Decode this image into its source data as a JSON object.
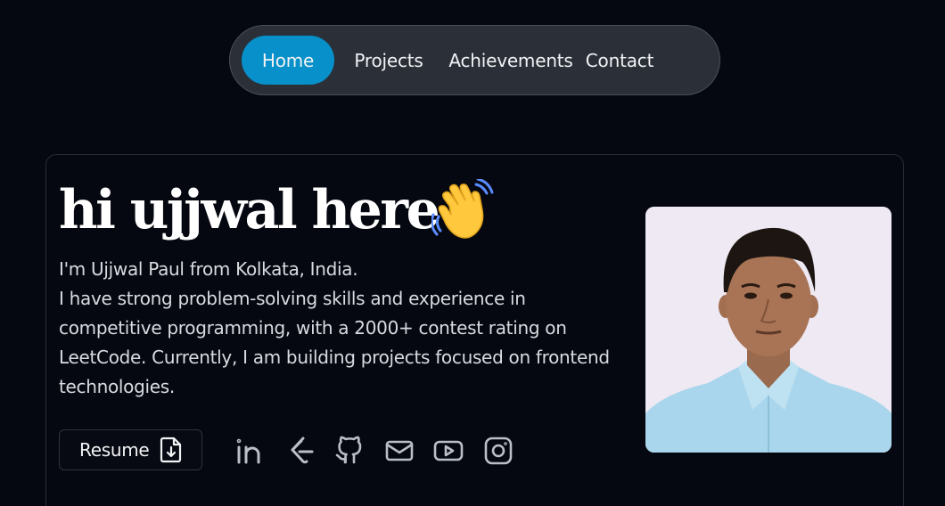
{
  "nav": {
    "items": [
      {
        "label": "Home",
        "active": true
      },
      {
        "label": "Projects",
        "active": false
      },
      {
        "label": "Achievements",
        "active": false
      },
      {
        "label": "Contact",
        "active": false
      }
    ]
  },
  "hero": {
    "title": "hi ujjwal here",
    "wave_icon": "waving-hand-icon",
    "bio_lines": [
      "I'm Ujjwal Paul from Kolkata, India.",
      "I have strong problem-solving skills and experience in competitive programming, with a 2000+ contest rating on LeetCode. Currently, I am building projects focused on frontend technologies."
    ],
    "resume_label": "Resume",
    "resume_icon": "file-download-icon",
    "socials": [
      {
        "icon": "linkedin-icon"
      },
      {
        "icon": "leetcode-icon"
      },
      {
        "icon": "github-icon"
      },
      {
        "icon": "mail-icon"
      },
      {
        "icon": "youtube-icon"
      },
      {
        "icon": "instagram-icon"
      }
    ],
    "photo": "profile-photo"
  },
  "colors": {
    "background": "#050810",
    "nav_bg": "#2b2f38",
    "accent": "#0790c9",
    "text": "#ffffff",
    "muted_text": "#d8dbe0",
    "icon": "#b9bec7"
  }
}
